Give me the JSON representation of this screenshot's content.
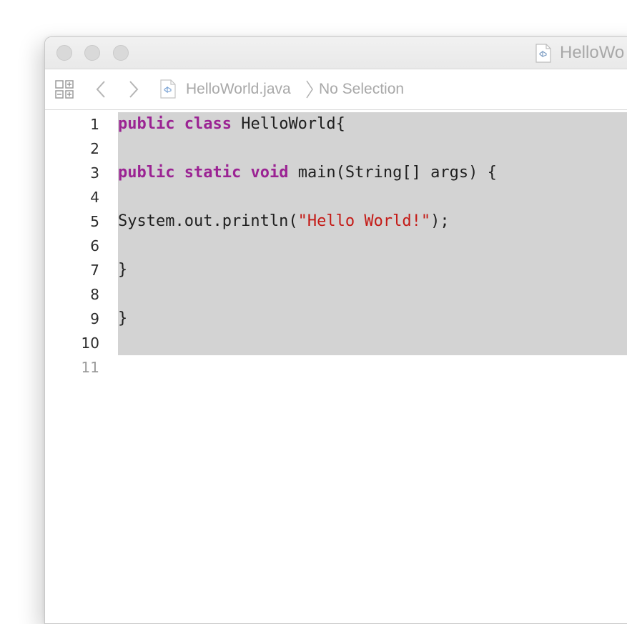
{
  "window": {
    "title": "HelloWo",
    "file_icon": "java-file-icon"
  },
  "pathbar": {
    "grid_icon": "related-items-grid-icon",
    "back_icon": "chevron-left-icon",
    "forward_icon": "chevron-right-icon",
    "file_name": "HelloWorld.java",
    "separator_icon": "path-separator-chevron-icon",
    "selection": "No Selection"
  },
  "editor": {
    "line_numbers": [
      "1",
      "2",
      "3",
      "4",
      "5",
      "6",
      "7",
      "8",
      "9",
      "10",
      "11"
    ],
    "lines": [
      [
        {
          "t": "public",
          "c": "kw"
        },
        {
          "t": " ",
          "c": ""
        },
        {
          "t": "class",
          "c": "kw"
        },
        {
          "t": " HelloWorld{",
          "c": ""
        }
      ],
      [],
      [
        {
          "t": "public",
          "c": "kw"
        },
        {
          "t": " ",
          "c": ""
        },
        {
          "t": "static",
          "c": "kw"
        },
        {
          "t": " ",
          "c": ""
        },
        {
          "t": "void",
          "c": "kw"
        },
        {
          "t": " main(String[] args) {",
          "c": ""
        }
      ],
      [],
      [
        {
          "t": "System.out.println(",
          "c": ""
        },
        {
          "t": "\"Hello World!\"",
          "c": "str"
        },
        {
          "t": ");",
          "c": ""
        }
      ],
      [],
      [
        {
          "t": "}",
          "c": ""
        }
      ],
      [],
      [
        {
          "t": "}",
          "c": ""
        }
      ],
      [],
      []
    ],
    "selected_lines": [
      "1",
      "2",
      "3",
      "4",
      "5",
      "6",
      "7",
      "8",
      "9",
      "10"
    ]
  },
  "colors": {
    "keyword": "#9b2393",
    "string": "#c41a16",
    "selection": "#d3d3d3",
    "text": "#1f1f1f"
  }
}
